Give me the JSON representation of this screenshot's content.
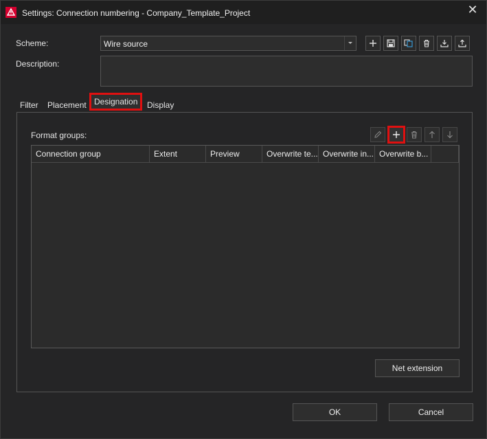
{
  "window": {
    "title": "Settings: Connection numbering - Company_Template_Project",
    "close_symbol": "✕"
  },
  "scheme": {
    "label": "Scheme:",
    "value": "Wire source",
    "buttons": [
      "plus-icon",
      "save-icon",
      "copy-icon",
      "trash-icon",
      "import-icon",
      "export-icon"
    ]
  },
  "description": {
    "label": "Description:",
    "value": ""
  },
  "tabs": [
    {
      "label": "Filter"
    },
    {
      "label": "Placement"
    },
    {
      "label": "Designation",
      "active": true
    },
    {
      "label": "Display"
    }
  ],
  "format_groups": {
    "label": "Format groups:",
    "toolbar": [
      "pencil-icon",
      "plus-icon",
      "trash-icon",
      "arrow-up-icon",
      "arrow-down-icon"
    ],
    "columns": [
      "Connection group",
      "Extent",
      "Preview",
      "Overwrite te...",
      "Overwrite in...",
      "Overwrite b..."
    ],
    "rows": []
  },
  "net_extension_label": "Net extension",
  "ok_label": "OK",
  "cancel_label": "Cancel",
  "colors": {
    "highlight": "#e01010",
    "brand": "#d6002f"
  }
}
